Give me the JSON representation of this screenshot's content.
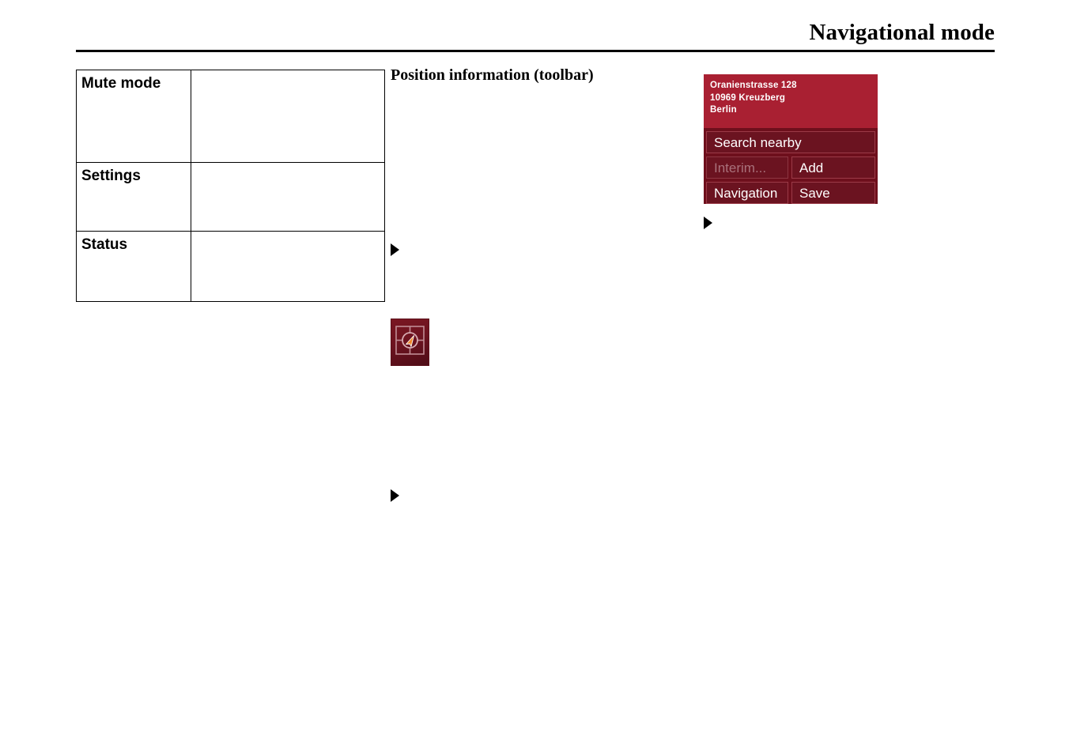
{
  "header": {
    "title": "Navigational mode"
  },
  "spec_table": {
    "rows": [
      {
        "label": "Mute mode",
        "value": ""
      },
      {
        "label": "Settings",
        "value": ""
      },
      {
        "label": "Status",
        "value": ""
      }
    ]
  },
  "middle_column": {
    "heading": "Position information (toolbar)",
    "bullets": [
      {
        "text": ""
      },
      {
        "text": ""
      }
    ],
    "nav_icon": {
      "name": "position-information-icon",
      "frame_color": "#c98f96",
      "arrow_color": "#f08a2a",
      "background_color": "#6d1420"
    }
  },
  "right_column": {
    "bullets": [
      {
        "text": ""
      }
    ],
    "device_screenshot": {
      "name": "position-information-toolbar",
      "header": {
        "background_color": "#a92032",
        "address_lines": [
          "Oranienstrasse 128",
          "10969 Kreuzberg",
          "Berlin"
        ]
      },
      "body_background_color": "#6e0f1c",
      "buttons": [
        {
          "label": "Search nearby",
          "disabled": false
        },
        {
          "label": "Interim...",
          "disabled": true
        },
        {
          "label": "Add",
          "disabled": false
        },
        {
          "label": "Navigation",
          "disabled": false
        },
        {
          "label": "Save",
          "disabled": false
        }
      ]
    }
  }
}
